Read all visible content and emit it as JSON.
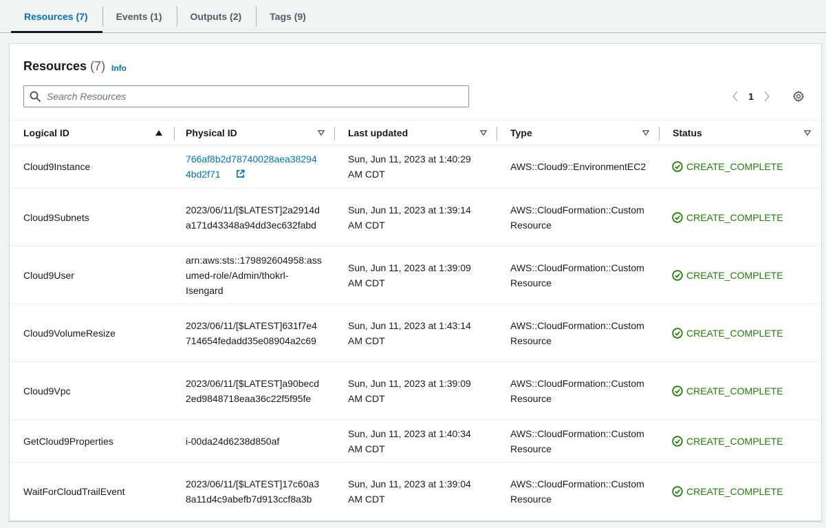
{
  "tabs": [
    {
      "label": "Resources (7)",
      "active": true
    },
    {
      "label": "Events (1)",
      "active": false
    },
    {
      "label": "Outputs (2)",
      "active": false
    },
    {
      "label": "Tags (9)",
      "active": false
    }
  ],
  "panel": {
    "title": "Resources",
    "count": "(7)",
    "info": "Info"
  },
  "search": {
    "placeholder": "Search Resources"
  },
  "pagination": {
    "page": "1"
  },
  "table": {
    "columns": [
      "Logical ID",
      "Physical ID",
      "Last updated",
      "Type",
      "Status"
    ],
    "rows": [
      {
        "logical_id": "Cloud9Instance",
        "physical_id": "766af8b2d78740028aea382944bd2f71",
        "physical_link": true,
        "last_updated": "Sun, Jun 11, 2023 at 1:40:29 AM CDT",
        "type": "AWS::Cloud9::EnvironmentEC2",
        "status": "CREATE_COMPLETE"
      },
      {
        "logical_id": "Cloud9Subnets",
        "physical_id": "2023/06/11/[$LATEST]2a2914da171d43348a94dd3ec632fabd",
        "physical_link": false,
        "last_updated": "Sun, Jun 11, 2023 at 1:39:14 AM CDT",
        "type": "AWS::CloudFormation::Custom Resource",
        "status": "CREATE_COMPLETE"
      },
      {
        "logical_id": "Cloud9User",
        "physical_id": "arn:aws:sts::179892604958:assumed-role/Admin/thokrl-Isengard",
        "physical_link": false,
        "last_updated": "Sun, Jun 11, 2023 at 1:39:09 AM CDT",
        "type": "AWS::CloudFormation::Custom Resource",
        "status": "CREATE_COMPLETE"
      },
      {
        "logical_id": "Cloud9VolumeResize",
        "physical_id": "2023/06/11/[$LATEST]631f7e4714654fedadd35e08904a2c69",
        "physical_link": false,
        "last_updated": "Sun, Jun 11, 2023 at 1:43:14 AM CDT",
        "type": "AWS::CloudFormation::Custom Resource",
        "status": "CREATE_COMPLETE"
      },
      {
        "logical_id": "Cloud9Vpc",
        "physical_id": "2023/06/11/[$LATEST]a90becd2ed9848718eaa36c22f5f95fe",
        "physical_link": false,
        "last_updated": "Sun, Jun 11, 2023 at 1:39:09 AM CDT",
        "type": "AWS::CloudFormation::Custom Resource",
        "status": "CREATE_COMPLETE"
      },
      {
        "logical_id": "GetCloud9Properties",
        "physical_id": "i-00da24d6238d850af",
        "physical_link": false,
        "last_updated": "Sun, Jun 11, 2023 at 1:40:34 AM CDT",
        "type": "AWS::CloudFormation::Custom Resource",
        "status": "CREATE_COMPLETE"
      },
      {
        "logical_id": "WaitForCloudTrailEvent",
        "physical_id": "2023/06/11/[$LATEST]17c60a38a11d4c9abefb7d913ccf8a3b",
        "physical_link": false,
        "last_updated": "Sun, Jun 11, 2023 at 1:39:04 AM CDT",
        "type": "AWS::CloudFormation::Custom Resource",
        "status": "CREATE_COMPLETE"
      }
    ]
  },
  "colors": {
    "link": "#0073bb",
    "success": "#1d8102",
    "border": "#eaeded"
  },
  "icons": {
    "search": "search-icon",
    "prev": "chevron-left-icon",
    "next": "chevron-right-icon",
    "settings": "gear-icon",
    "sort_asc": "caret-up-icon",
    "sort": "caret-down-icon",
    "external": "external-link-icon",
    "status": "check-circle-icon"
  }
}
